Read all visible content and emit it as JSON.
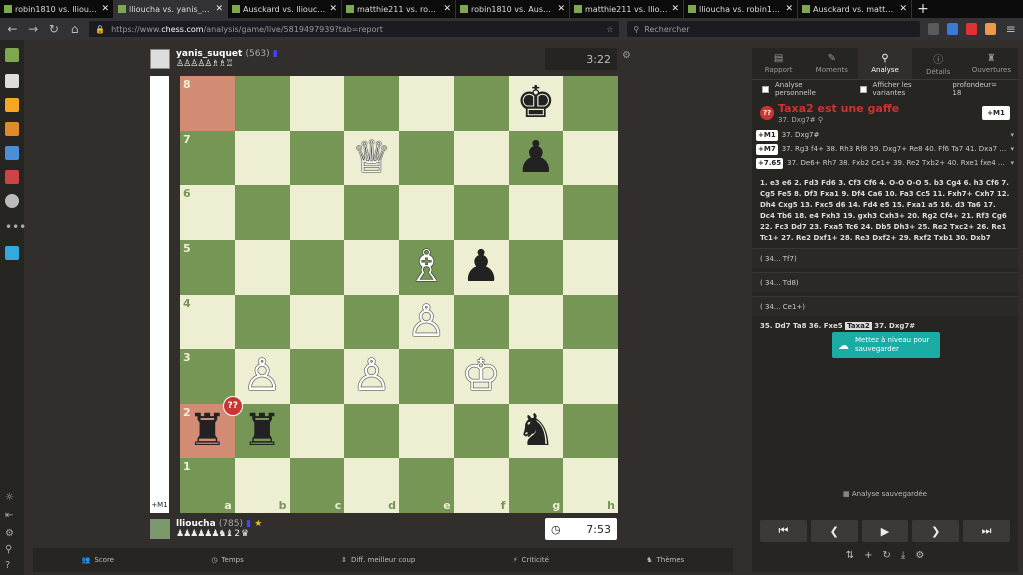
{
  "browser": {
    "tabs": [
      {
        "label": "robin1810 vs. llioucha | Ana",
        "active": false
      },
      {
        "label": "llioucha vs. yanis_suquet | An",
        "active": true
      },
      {
        "label": "Ausckard vs. llioucha | Analy",
        "active": false
      },
      {
        "label": "matthie211 vs. robin1810 | An",
        "active": false
      },
      {
        "label": "robin1810 vs. Ausckard | Ana",
        "active": false
      },
      {
        "label": "matthie211 vs. llioucha | Ana",
        "active": false
      },
      {
        "label": "llioucha vs. robin1810 | Anal",
        "active": false
      },
      {
        "label": "Ausckard vs. matthie211 | Ana",
        "active": false
      }
    ],
    "close_glyph": "✕",
    "new_tab_glyph": "+",
    "url_prefix": "https://www.",
    "url_host": "chess.com",
    "url_path": "/analysis/game/live/5819497939?tab=report",
    "search_placeholder": "Rechercher"
  },
  "top_player": {
    "name": "yanis_suquet",
    "rating": "(563)",
    "captured": "♙♙♙♙♙♗♗♖",
    "clock": "3:22"
  },
  "bottom_player": {
    "name": "llioucha",
    "rating": "(785)",
    "captured": "♟♟♟♟♟♟♞♝ 2 ♛",
    "clock": "7:53"
  },
  "eval_label": "+M1",
  "board": {
    "ranks": [
      "8",
      "7",
      "6",
      "5",
      "4",
      "3",
      "2",
      "1"
    ],
    "files": [
      "a",
      "b",
      "c",
      "d",
      "e",
      "f",
      "g",
      "h"
    ],
    "pieces": {
      "g8": "♚",
      "d7": "♕",
      "g7": "♟",
      "e5": "♗",
      "f5": "♟",
      "e4": "♙",
      "b3": "♙",
      "d3": "♙",
      "f3": "♔",
      "a2": "♜",
      "b2": "♜",
      "g2": "♞"
    },
    "white_pieces": [
      "d7",
      "e5",
      "e4",
      "b3",
      "d3",
      "f3"
    ],
    "highlight": [
      "a8",
      "a2"
    ],
    "blunder_square": "a2",
    "blunder_label": "??"
  },
  "bottom_bar": [
    {
      "label": "Score",
      "icon": "👥"
    },
    {
      "label": "Temps",
      "icon": "◷"
    },
    {
      "label": "Diff. meilleur coup",
      "icon": "⇕"
    },
    {
      "label": "Criticité",
      "icon": "⚡"
    },
    {
      "label": "Thèmes",
      "icon": "♞"
    }
  ],
  "panel": {
    "tabs": [
      {
        "label": "Rapport",
        "icon": "▤",
        "active": false
      },
      {
        "label": "Moments",
        "icon": "✎",
        "active": false
      },
      {
        "label": "Analyse",
        "icon": "⚲",
        "active": true
      },
      {
        "label": "Détails",
        "icon": "ⓘ",
        "active": false
      },
      {
        "label": "Ouvertures",
        "icon": "♜",
        "active": false
      }
    ],
    "opt_personal": "Analyse personnelle",
    "opt_variants": "Afficher les variantes",
    "depth": "profondeur= 18",
    "verdict_badge": "??",
    "verdict_title": "Taxa2 est une gaffe",
    "verdict_sub": "37. Dxg7# ⚲",
    "verdict_eval": "+M1",
    "lines": [
      {
        "eval": "+M1",
        "moves": "37. Dxg7#"
      },
      {
        "eval": "+M7",
        "moves": "37. Rg3 f4+ 38. Rh3 Rf8 39. Dxg7+ Re8 40. Ff6 Ta7 41. Dxa7 Rf8 42. D..."
      },
      {
        "eval": "+7.65",
        "moves": "37. De6+ Rh7 38. Fxb2 Ce1+ 39. Re2 Txb2+ 40. Rxe1 fxe4 41. Df5+ g6..."
      }
    ],
    "dropdown_glyph": "▾",
    "moves_text": "1. e3 e6 2. Fd3 Fd6 3. Cf3 Cf6 4. O-O O-O 5. b3 Cg4 6. h3 Cf6 7. Cg5 Fe5 8. Df3 Fxa1 9. Df4 Ca6 10. Fa3 Cc5 11. Fxh7+ Cxh7 12. Dh4 Cxg5 13. Fxc5 d6 14. Fd4 e5 15. Fxa1 a5 16. d3 Ta6 17. Dc4 Tb6 18. e4 Fxh3 19. gxh3 Cxh3+ 20. Rg2 Cf4+ 21. Rf3 Cg6 22. Fc3 Dd7 23. Fxa5 Tc6 24. Db5 Dh3+ 25. Re2 Txc2+ 26. Re1 Tc1+ 27. Re2 Dxf1+ 28. Re3 Dxf2+ 29. Rxf2 Txb1 30. Dxb7 Tb2+ 31. Re3 Ch4 32. Fxc7 Cg2+ 33. Rf3 f5 34. Fxd6 Te8",
    "variations": [
      "( 34... Tf7)",
      "( 34... Td8)",
      "( 34... Ce1+)"
    ],
    "mainline_pre": "35. Dd7 Ta8 36. Fxe5",
    "mainline_cur": "Taxa2",
    "mainline_post": "37. Dxg7#",
    "save_line1": "Mettez à niveau pour",
    "save_line2": "sauvegarder",
    "saved_label": "Analyse sauvegardée",
    "controls": [
      "⏮",
      "❮",
      "▶",
      "❯",
      "⏭"
    ],
    "tools": [
      "⇅",
      "+",
      "↻",
      "⤓",
      "⚙"
    ]
  }
}
